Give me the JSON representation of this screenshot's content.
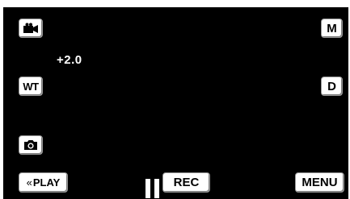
{
  "top": {
    "mode_icon": "video-camera-icon",
    "manual_label": "M"
  },
  "exposure": {
    "value": "+2.0"
  },
  "zoom": {
    "wide_tele_label": "WT",
    "display_label": "D"
  },
  "left": {
    "snapshot_icon": "camera-icon"
  },
  "bottom": {
    "play_label": "PLAY",
    "play_icon": "double-chevron-left-icon",
    "pause_icon": "pause-icon",
    "rec_label": "REC",
    "menu_label": "MENU"
  },
  "colors": {
    "screen": "#000000",
    "button": "#ffffff",
    "text": "#000000",
    "overlay_text": "#ffffff"
  }
}
